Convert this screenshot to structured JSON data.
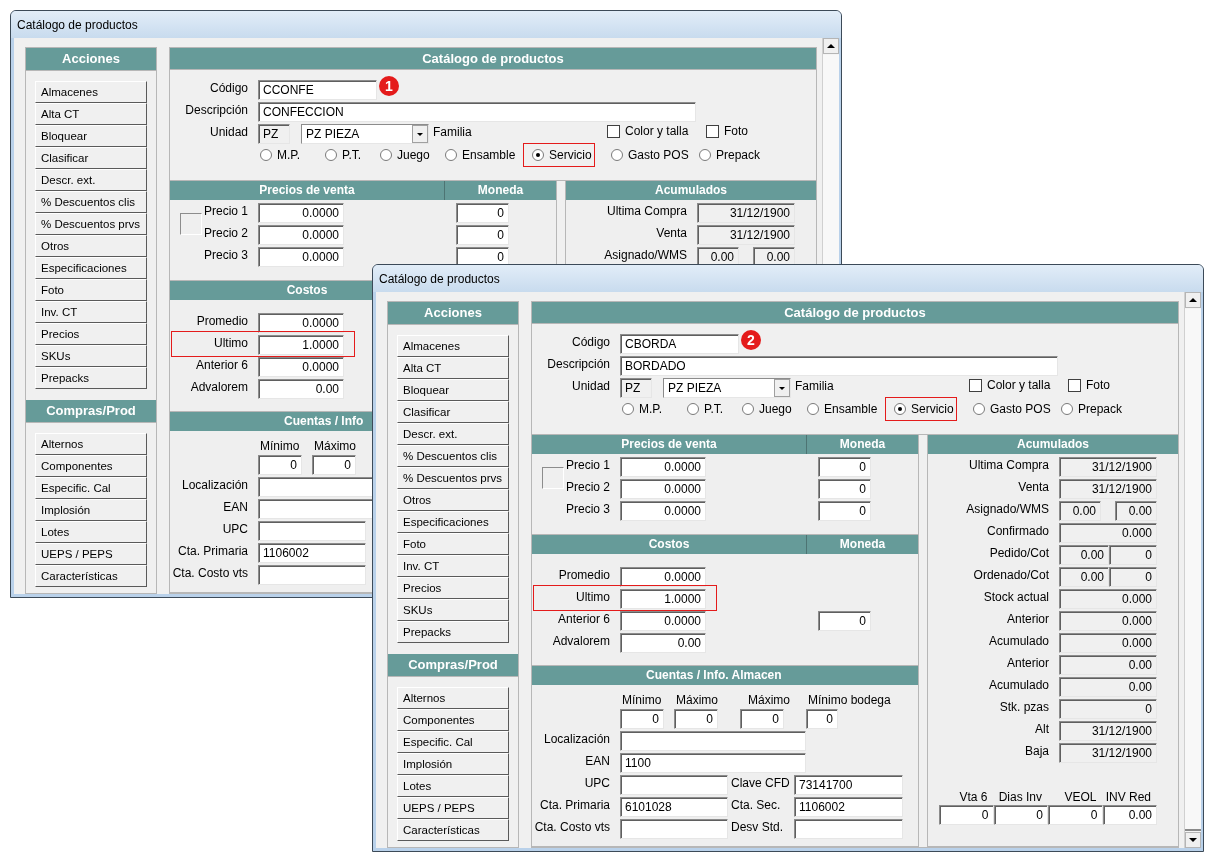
{
  "windows": [
    {
      "title": "Catálogo de productos",
      "sidebar": [
        {
          "heading": "Acciones",
          "items": [
            "Almacenes",
            "Alta CT",
            "Bloquear",
            "Clasificar",
            "Descr. ext.",
            "% Descuentos clis",
            "% Descuentos prvs",
            "Otros",
            "Especificaciones",
            "Foto",
            "Inv. CT",
            "Precios",
            "SKUs",
            "Prepacks"
          ]
        },
        {
          "heading": "Compras/Prod",
          "items": [
            "Alternos",
            "Componentes",
            "Especific. Cal",
            "Implosión",
            "Lotes",
            "UEPS / PEPS",
            "Características"
          ]
        }
      ],
      "form": {
        "heading": "Catálogo de productos",
        "badge": "1",
        "fields": [
          {
            "label": "Código",
            "value": "CCONFE"
          },
          {
            "label": "Descripción",
            "value": "CONFECCION"
          }
        ],
        "unidad": {
          "label": "Unidad",
          "code": "PZ",
          "value": "PZ PIEZA"
        },
        "familia": "Familia",
        "checkboxes": [
          {
            "label": "Color y talla",
            "checked": false
          },
          {
            "label": "Foto",
            "checked": false
          }
        ],
        "types": [
          {
            "label": "M.P.",
            "selected": false,
            "highlighted": false
          },
          {
            "label": "P.T.",
            "selected": false,
            "highlighted": false
          },
          {
            "label": "Juego",
            "selected": false,
            "highlighted": false
          },
          {
            "label": "Ensamble",
            "selected": false,
            "highlighted": false
          },
          {
            "label": "Servicio",
            "selected": true,
            "highlighted": true
          },
          {
            "label": "Gasto POS",
            "selected": false,
            "highlighted": false
          },
          {
            "label": "Prepack",
            "selected": false,
            "highlighted": false
          }
        ]
      },
      "precios": {
        "heading": "Precios de venta",
        "moneda_heading": "Moneda",
        "rows": [
          {
            "label": "Precio 1",
            "value": "0.0000",
            "moneda": "0"
          },
          {
            "label": "Precio 2",
            "value": "0.0000",
            "moneda": "0"
          },
          {
            "label": "Precio 3",
            "value": "0.0000",
            "moneda": "0"
          }
        ]
      },
      "costos": {
        "heading": "Costos",
        "rows": [
          {
            "label": "Promedio",
            "value": "0.0000",
            "highlighted": false
          },
          {
            "label": "Ultimo",
            "value": "1.0000",
            "highlighted": true
          },
          {
            "label": "Anterior 6",
            "value": "0.0000",
            "highlighted": false
          },
          {
            "label": "Advalorem",
            "value": "0.00",
            "highlighted": false
          }
        ]
      },
      "cuentas": {
        "heading": "Cuentas / Info",
        "limits": [
          {
            "label": "Mínimo",
            "value": "0"
          },
          {
            "label": "Máximo",
            "value": "0"
          }
        ],
        "rows": [
          {
            "label": "Localización",
            "kind": "wide"
          },
          {
            "label": "EAN",
            "kind": "wide"
          },
          {
            "label": "UPC",
            "kind": "short"
          },
          {
            "label": "Cta. Primaria",
            "kind": "short",
            "value": "1106002"
          },
          {
            "label": "Cta. Costo vts",
            "kind": "short"
          }
        ]
      },
      "acumulados": {
        "heading": "Acumulados",
        "rows": [
          {
            "label": "Ultima Compra",
            "kind": "single",
            "values": [
              "31/12/1900"
            ]
          },
          {
            "label": "Venta",
            "kind": "single",
            "values": [
              "31/12/1900"
            ]
          },
          {
            "label": "Asignado/WMS",
            "kind": "pair",
            "values": [
              "0.00",
              "0.00"
            ]
          }
        ]
      }
    },
    {
      "title": "Catálogo de productos",
      "sidebar": [
        {
          "heading": "Acciones",
          "items": [
            "Almacenes",
            "Alta CT",
            "Bloquear",
            "Clasificar",
            "Descr. ext.",
            "% Descuentos clis",
            "% Descuentos prvs",
            "Otros",
            "Especificaciones",
            "Foto",
            "Inv. CT",
            "Precios",
            "SKUs",
            "Prepacks"
          ]
        },
        {
          "heading": "Compras/Prod",
          "items": [
            "Alternos",
            "Componentes",
            "Especific. Cal",
            "Implosión",
            "Lotes",
            "UEPS / PEPS",
            "Características"
          ]
        }
      ],
      "form": {
        "heading": "Catálogo de productos",
        "badge": "2",
        "fields": [
          {
            "label": "Código",
            "value": "CBORDA"
          },
          {
            "label": "Descripción",
            "value": "BORDADO"
          }
        ],
        "unidad": {
          "label": "Unidad",
          "code": "PZ",
          "value": "PZ PIEZA"
        },
        "familia": "Familia",
        "checkboxes": [
          {
            "label": "Color y talla",
            "checked": false
          },
          {
            "label": "Foto",
            "checked": false
          }
        ],
        "types": [
          {
            "label": "M.P.",
            "selected": false,
            "highlighted": false
          },
          {
            "label": "P.T.",
            "selected": false,
            "highlighted": false
          },
          {
            "label": "Juego",
            "selected": false,
            "highlighted": false
          },
          {
            "label": "Ensamble",
            "selected": false,
            "highlighted": false
          },
          {
            "label": "Servicio",
            "selected": true,
            "highlighted": true
          },
          {
            "label": "Gasto POS",
            "selected": false,
            "highlighted": false
          },
          {
            "label": "Prepack",
            "selected": false,
            "highlighted": false
          }
        ]
      },
      "precios": {
        "heading": "Precios de venta",
        "moneda_heading": "Moneda",
        "rows": [
          {
            "label": "Precio 1",
            "value": "0.0000",
            "moneda": "0"
          },
          {
            "label": "Precio 2",
            "value": "0.0000",
            "moneda": "0"
          },
          {
            "label": "Precio 3",
            "value": "0.0000",
            "moneda": "0"
          }
        ]
      },
      "costos": {
        "heading": "Costos",
        "moneda_heading": "Moneda",
        "rows": [
          {
            "label": "Promedio",
            "value": "0.0000",
            "highlighted": false
          },
          {
            "label": "Ultimo",
            "value": "1.0000",
            "highlighted": true
          },
          {
            "label": "Anterior 6",
            "value": "0.0000",
            "highlighted": false,
            "moneda": "0"
          },
          {
            "label": "Advalorem",
            "value": "0.00",
            "highlighted": false
          }
        ]
      },
      "cuentas": {
        "heading": "Cuentas / Info. Almacen",
        "limits": [
          {
            "label": "Mínimo",
            "value": "0"
          },
          {
            "label": "Máximo",
            "value": "0"
          },
          {
            "label": "Máximo",
            "value": "0"
          },
          {
            "label": "Mínimo bodega",
            "value": "0"
          }
        ],
        "rows": [
          {
            "label": "Localización",
            "kind": "wide"
          },
          {
            "label": "EAN",
            "kind": "wide",
            "value": "1100"
          },
          {
            "label": "UPC",
            "kind": "short",
            "extra": {
              "label": "Clave CFD",
              "value": "73141700"
            }
          },
          {
            "label": "Cta. Primaria",
            "kind": "short",
            "value": "6101028",
            "extra": {
              "label": "Cta. Sec.",
              "value": "1106002"
            }
          },
          {
            "label": "Cta. Costo vts",
            "kind": "short",
            "extra": {
              "label": "Desv Std."
            }
          }
        ]
      },
      "acumulados": {
        "heading": "Acumulados",
        "rows": [
          {
            "label": "Ultima Compra",
            "kind": "single",
            "values": [
              "31/12/1900"
            ]
          },
          {
            "label": "Venta",
            "kind": "single",
            "values": [
              "31/12/1900"
            ]
          },
          {
            "label": "Asignado/WMS",
            "kind": "pair",
            "values": [
              "0.00",
              "0.00"
            ]
          },
          {
            "label": "Confirmado",
            "kind": "single",
            "values": [
              "0.000"
            ]
          },
          {
            "label": "Pedido/Cot",
            "kind": "joined",
            "values": [
              "0.00",
              "0"
            ]
          },
          {
            "label": "Ordenado/Cot",
            "kind": "joined",
            "values": [
              "0.00",
              "0"
            ]
          },
          {
            "label": "Stock actual",
            "kind": "single",
            "values": [
              "0.000"
            ]
          },
          {
            "label": "Anterior",
            "kind": "single",
            "values": [
              "0.000"
            ]
          },
          {
            "label": "Acumulado",
            "kind": "single",
            "values": [
              "0.000"
            ]
          },
          {
            "label": "Anterior",
            "kind": "single",
            "values": [
              "0.00"
            ]
          },
          {
            "label": "Acumulado",
            "kind": "single",
            "values": [
              "0.00"
            ]
          },
          {
            "label": "Stk. pzas",
            "kind": "single",
            "values": [
              "0"
            ]
          },
          {
            "label": "Alt",
            "kind": "single",
            "values": [
              "31/12/1900"
            ]
          },
          {
            "label": "Baja",
            "kind": "single",
            "values": [
              "31/12/1900"
            ]
          }
        ],
        "totals": [
          {
            "label": "Vta 6",
            "value": "0"
          },
          {
            "label": "Dias Inv",
            "value": "0"
          },
          {
            "label": "VEOL",
            "value": "0"
          },
          {
            "label": "INV Red",
            "value": "0.00"
          }
        ]
      }
    }
  ]
}
